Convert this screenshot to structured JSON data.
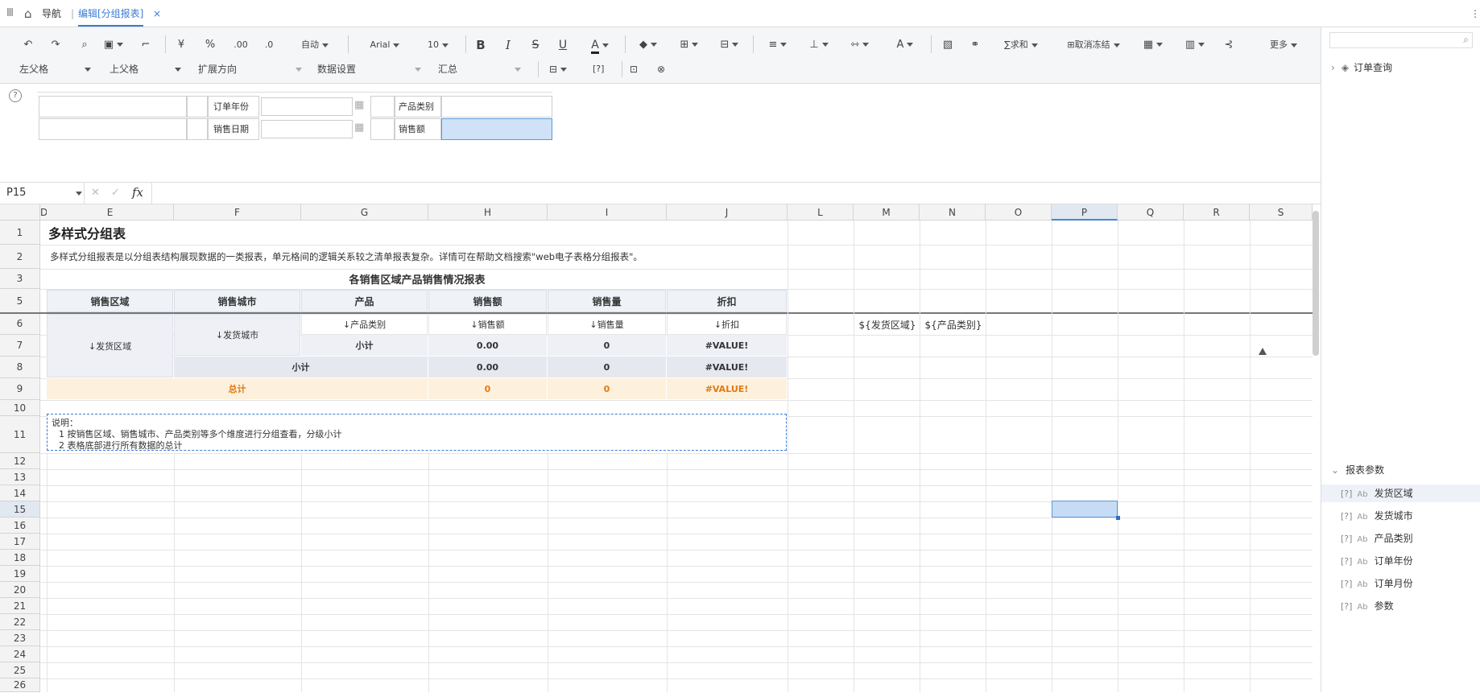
{
  "topbar": {
    "menu_icon": "grid-menu-icon",
    "home_icon": "home-icon",
    "nav_label": "导航",
    "edit_tab": "编辑[分组报表]",
    "close": "×",
    "more": "⋮"
  },
  "toolbar": {
    "auto": "自动",
    "font": "Arial",
    "size": "10",
    "sum": "求和",
    "freeze": "取消冻结",
    "more": "更多",
    "yen": "¥",
    "percent": "%",
    "dec_inc": ".00",
    "dec_dec": ".0",
    "bold": "B",
    "italic": "I",
    "strike": "S",
    "underline": "U",
    "color_a": "A",
    "formula_tag": "[?]"
  },
  "toolbar2": {
    "left_parent": "左父格",
    "top_parent": "上父格",
    "expand": "扩展方向",
    "data_setting": "数据设置",
    "aggregate": "汇总"
  },
  "params": {
    "order_year": "订单年份",
    "product_category": "产品类别",
    "sale_date": "销售日期",
    "sales_amount": "销售额",
    "help": "?"
  },
  "formula_bar": {
    "cell_ref": "P15",
    "fx": "fx",
    "cancel": "✕",
    "confirm": "✓"
  },
  "columns": [
    "D",
    "E",
    "F",
    "G",
    "H",
    "I",
    "J",
    "L",
    "M",
    "N",
    "O",
    "P",
    "Q",
    "R",
    "S"
  ],
  "rows": [
    "1",
    "2",
    "3",
    "5",
    "6",
    "7",
    "8",
    "9",
    "10",
    "11",
    "12",
    "13",
    "14",
    "15",
    "16",
    "17",
    "18",
    "19",
    "20",
    "21",
    "22",
    "23",
    "24",
    "25",
    "26"
  ],
  "sheet": {
    "title": "多样式分组表",
    "description": "多样式分组报表是以分组表结构展现数据的一类报表，单元格间的逻辑关系较之清单报表复杂。详情可在帮助文档搜索\"web电子表格分组报表\"。",
    "report_title": "各销售区域产品销售情况报表",
    "headers": [
      "销售区域",
      "销售城市",
      "产品",
      "销售额",
      "销售量",
      "折扣"
    ],
    "r6": [
      "↓产品类别",
      "↓销售额",
      "↓销售量",
      "↓折扣"
    ],
    "region": "↓发货区域",
    "city": "↓发货城市",
    "r7": [
      "小计",
      "0.00",
      "0",
      "#VALUE!"
    ],
    "r8": [
      "小计",
      "0.00",
      "0",
      "#VALUE!"
    ],
    "r9": [
      "总计",
      "0",
      "0",
      "#VALUE!"
    ],
    "m6": "${发货区域}",
    "n6": "${产品类别}",
    "note_title": "说明：",
    "note_1": "1  按销售区域、销售城市、产品类别等多个维度进行分组查看，分级小计",
    "note_2": "2  表格底部进行所有数据的总计"
  },
  "sidebar": {
    "tree_item": "订单查询",
    "section": "报表参数",
    "params": [
      "发货区域",
      "发货城市",
      "产品类别",
      "订单年份",
      "订单月份",
      "参数"
    ],
    "q": "[?]",
    "ab": "Ab"
  }
}
